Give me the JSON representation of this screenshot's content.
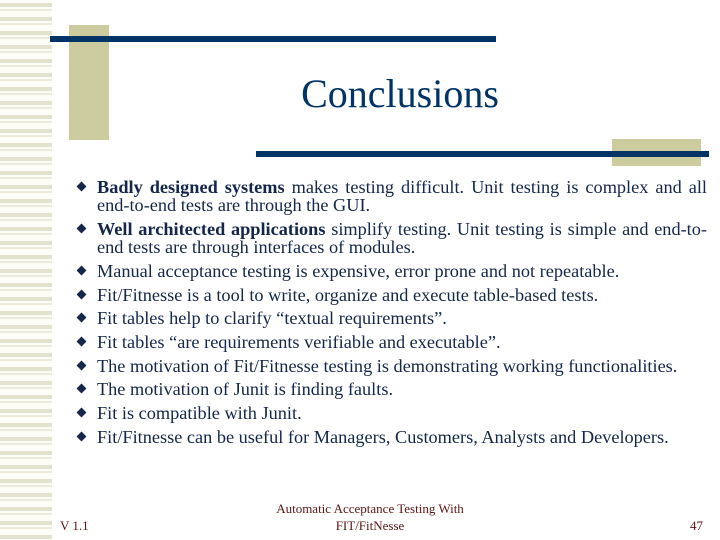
{
  "slide": {
    "title": "Conclusions",
    "bullets": [
      {
        "bold": "Badly designed systems",
        "text": " makes testing difficult. Unit testing is complex and all end-to-end tests are through the GUI."
      },
      {
        "bold": "Well architected applications",
        "text": " simplify testing. Unit testing is simple and end-to-end tests are through interfaces of modules."
      },
      {
        "bold": "",
        "text": "Manual acceptance testing is expensive, error prone and not repeatable."
      },
      {
        "bold": "",
        "text": "Fit/Fitnesse is a tool to write, organize and execute table-based tests."
      },
      {
        "bold": "",
        "text": "Fit tables help to clarify “textual requirements”."
      },
      {
        "bold": "",
        "text": "Fit tables “are requirements verifiable and executable”."
      },
      {
        "bold": "",
        "text": "The motivation of Fit/Fitnesse testing is demonstrating working functionalities."
      },
      {
        "bold": "",
        "text": "The motivation of Junit is finding faults."
      },
      {
        "bold": "",
        "text": "Fit is compatible with Junit."
      },
      {
        "bold": "",
        "text": "Fit/Fitnesse can be useful for Managers, Customers, Analysts and Developers."
      }
    ],
    "icons": {
      "bullet": "diamond-bullet-icon"
    }
  },
  "footer": {
    "version": "V 1.1",
    "center_line1": "Automatic Acceptance Testing With",
    "center_line2": "FIT/FitNesse",
    "page_number": "47"
  },
  "colors": {
    "title": "#003366",
    "accent_navy": "#003366",
    "accent_tan": "#cccc9f",
    "body_text": "#14264a",
    "footer_text": "#5c1414"
  }
}
